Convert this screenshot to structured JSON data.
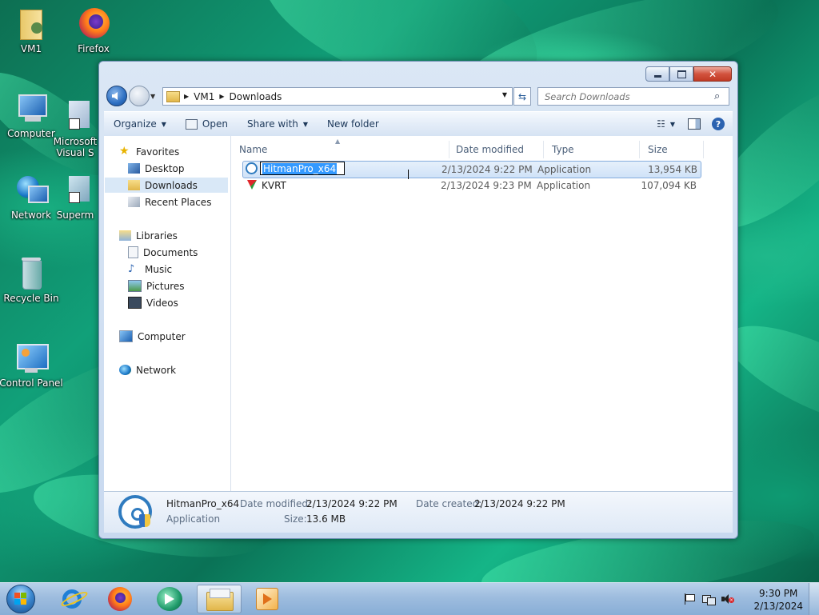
{
  "desktop": {
    "icons": [
      {
        "label": "VM1",
        "icon": "user-folder-icon"
      },
      {
        "label": "Firefox",
        "icon": "firefox-icon"
      },
      {
        "label": "Computer",
        "icon": "computer-icon"
      },
      {
        "label": "Microsoft Visual S",
        "icon": "visual-studio-icon"
      },
      {
        "label": "Network",
        "icon": "network-icon"
      },
      {
        "label": "Superm",
        "icon": "shortcut-icon"
      },
      {
        "label": "Recycle Bin",
        "icon": "recycle-bin-icon"
      },
      {
        "label": "Control Panel",
        "icon": "control-panel-icon"
      }
    ]
  },
  "explorer": {
    "address": {
      "segments": [
        "VM1",
        "Downloads"
      ]
    },
    "search_placeholder": "Search Downloads",
    "toolbar": {
      "organize": "Organize",
      "open": "Open",
      "share_with": "Share with",
      "new_folder": "New folder"
    },
    "nav": {
      "favorites": "Favorites",
      "desktop": "Desktop",
      "downloads": "Downloads",
      "recent_places": "Recent Places",
      "libraries": "Libraries",
      "documents": "Documents",
      "music": "Music",
      "pictures": "Pictures",
      "videos": "Videos",
      "computer": "Computer",
      "network": "Network"
    },
    "columns": {
      "name": "Name",
      "date_modified": "Date modified",
      "type": "Type",
      "size": "Size"
    },
    "files": [
      {
        "name": "HitmanPro_x64",
        "date": "2/13/2024 9:22 PM",
        "type": "Application",
        "size": "13,954 KB"
      },
      {
        "name": "KVRT",
        "date": "2/13/2024 9:23 PM",
        "type": "Application",
        "size": "107,094 KB"
      }
    ],
    "details": {
      "name": "HitmanPro_x64",
      "kind": "Application",
      "date_modified_label": "Date modified:",
      "date_modified": "2/13/2024 9:22 PM",
      "date_created_label": "Date created:",
      "date_created": "2/13/2024 9:22 PM",
      "size_label": "Size:",
      "size": "13.6 MB"
    }
  },
  "taskbar": {
    "apps": [
      "internet-explorer-icon",
      "firefox-icon",
      "media-center-icon",
      "windows-explorer-icon",
      "media-player-icon"
    ],
    "clock": {
      "time": "9:30 PM",
      "date": "2/13/2024"
    }
  },
  "colors": {
    "selection": "#3399ff",
    "accent": "#2d6fc2"
  }
}
